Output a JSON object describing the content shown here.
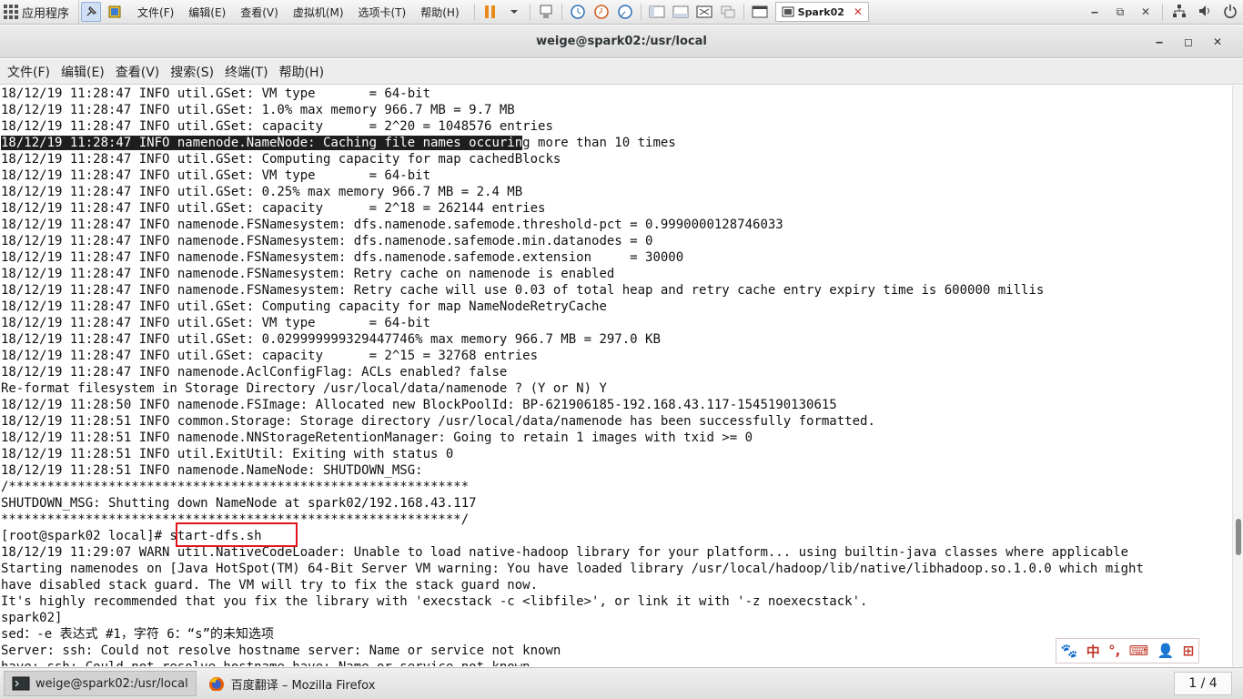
{
  "vmware": {
    "apps_label": "应用程序",
    "menus": [
      "文件(F)",
      "编辑(E)",
      "查看(V)",
      "虚拟机(M)",
      "选项卡(T)",
      "帮助(H)"
    ],
    "tab_label": "Spark02"
  },
  "window": {
    "title": "weige@spark02:/usr/local",
    "minimize": "‒",
    "maximize": "◻",
    "close": "✕"
  },
  "terminal_menu": [
    "文件(F)",
    "编辑(E)",
    "查看(V)",
    "搜索(S)",
    "终端(T)",
    "帮助(H)"
  ],
  "terminal": {
    "lines": [
      "18/12/19 11:28:47 INFO util.GSet: VM type       = 64-bit",
      "18/12/19 11:28:47 INFO util.GSet: 1.0% max memory 966.7 MB = 9.7 MB",
      "18/12/19 11:28:47 INFO util.GSet: capacity      = 2^20 = 1048576 entries",
      "18/12/19 11:28:47 INFO namenode.NameNode: Caching file names occuring more than 10 times",
      "18/12/19 11:28:47 INFO util.GSet: Computing capacity for map cachedBlocks",
      "18/12/19 11:28:47 INFO util.GSet: VM type       = 64-bit",
      "18/12/19 11:28:47 INFO util.GSet: 0.25% max memory 966.7 MB = 2.4 MB",
      "18/12/19 11:28:47 INFO util.GSet: capacity      = 2^18 = 262144 entries",
      "18/12/19 11:28:47 INFO namenode.FSNamesystem: dfs.namenode.safemode.threshold-pct = 0.9990000128746033",
      "18/12/19 11:28:47 INFO namenode.FSNamesystem: dfs.namenode.safemode.min.datanodes = 0",
      "18/12/19 11:28:47 INFO namenode.FSNamesystem: dfs.namenode.safemode.extension     = 30000",
      "18/12/19 11:28:47 INFO namenode.FSNamesystem: Retry cache on namenode is enabled",
      "18/12/19 11:28:47 INFO namenode.FSNamesystem: Retry cache will use 0.03 of total heap and retry cache entry expiry time is 600000 millis",
      "18/12/19 11:28:47 INFO util.GSet: Computing capacity for map NameNodeRetryCache",
      "18/12/19 11:28:47 INFO util.GSet: VM type       = 64-bit",
      "18/12/19 11:28:47 INFO util.GSet: 0.029999999329447746% max memory 966.7 MB = 297.0 KB",
      "18/12/19 11:28:47 INFO util.GSet: capacity      = 2^15 = 32768 entries",
      "18/12/19 11:28:47 INFO namenode.AclConfigFlag: ACLs enabled? false",
      "Re-format filesystem in Storage Directory /usr/local/data/namenode ? (Y or N) Y",
      "18/12/19 11:28:50 INFO namenode.FSImage: Allocated new BlockPoolId: BP-621906185-192.168.43.117-1545190130615",
      "18/12/19 11:28:51 INFO common.Storage: Storage directory /usr/local/data/namenode has been successfully formatted.",
      "18/12/19 11:28:51 INFO namenode.NNStorageRetentionManager: Going to retain 1 images with txid >= 0",
      "18/12/19 11:28:51 INFO util.ExitUtil: Exiting with status 0",
      "18/12/19 11:28:51 INFO namenode.NameNode: SHUTDOWN_MSG:",
      "/************************************************************",
      "SHUTDOWN_MSG: Shutting down NameNode at spark02/192.168.43.117",
      "************************************************************/",
      "[root@spark02 local]# start-dfs.sh",
      "18/12/19 11:29:07 WARN util.NativeCodeLoader: Unable to load native-hadoop library for your platform... using builtin-java classes where applicable",
      "Starting namenodes on [Java HotSpot(TM) 64-Bit Server VM warning: You have loaded library /usr/local/hadoop/lib/native/libhadoop.so.1.0.0 which might",
      "have disabled stack guard. The VM will try to fix the stack guard now.",
      "It's highly recommended that you fix the library with 'execstack -c <libfile>', or link it with '-z noexecstack'.",
      "spark02]",
      "sed：-e 表达式 #1，字符 6：“s”的未知选项",
      "Server: ssh: Could not resolve hostname server: Name or service not known",
      "have: ssh: Could not resolve hostname have: Name or service not known"
    ],
    "highlight_line_index": 3,
    "highlight_prefix": "18/12/19 11:28:47 INFO namenode.NameNode: Caching file names occurin",
    "highlight_suffix": "g more than 10 times"
  },
  "ime": [
    "🐾",
    "中",
    "°,",
    "⌨",
    "👤",
    "⊞"
  ],
  "taskbar": {
    "items": [
      {
        "label": "weige@spark02:/usr/local",
        "active": true
      },
      {
        "label": "百度翻译 – Mozilla Firefox",
        "active": false
      }
    ],
    "pager": "1 / 4"
  },
  "colors": {
    "highlight_bg": "#1e1e1e",
    "annotation_box": "#e1141a"
  }
}
